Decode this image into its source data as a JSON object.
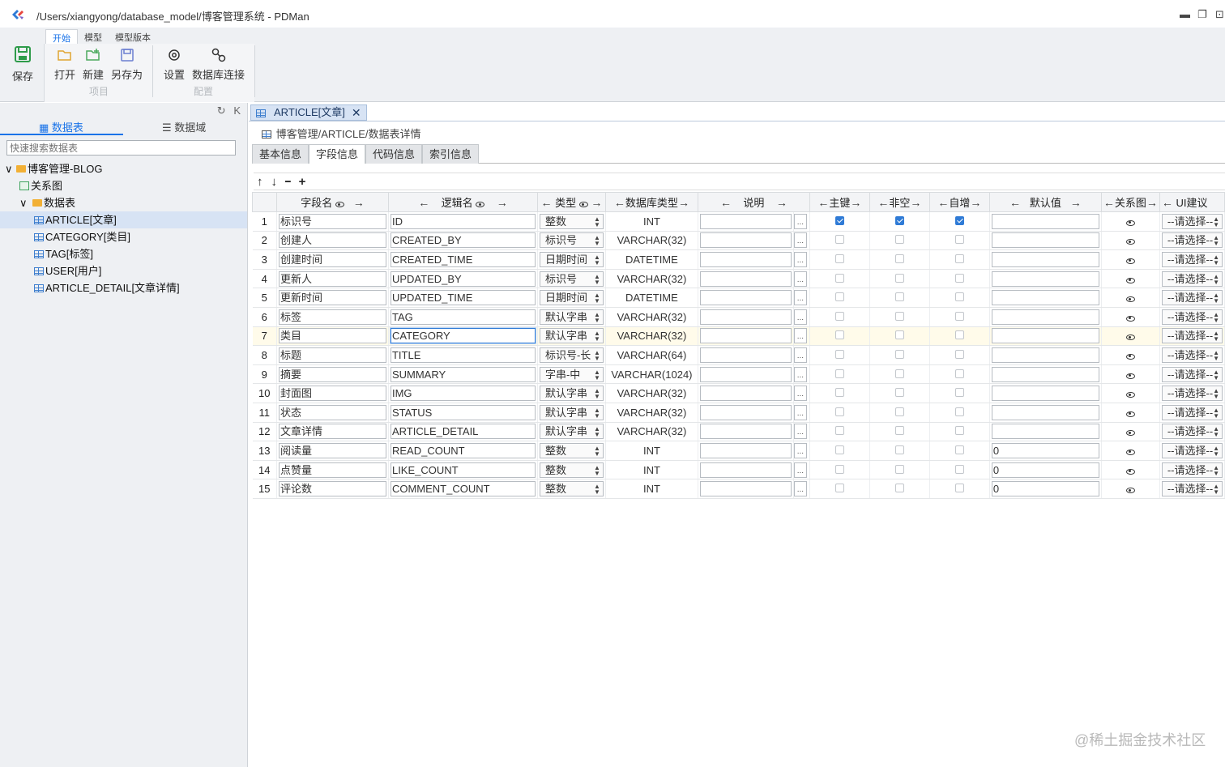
{
  "window": {
    "title": "/Users/xiangyong/database_model/博客管理系统 - PDMan",
    "controls": [
      "▬",
      "❐",
      "⊡"
    ]
  },
  "ribbon": {
    "tabs": [
      "开始",
      "模型",
      "模型版本"
    ],
    "save_label": "保存",
    "open_label": "打开",
    "new_label": "新建",
    "saveas_label": "另存为",
    "project_group": "项目",
    "settings_label": "设置",
    "dbconn_label": "数据库连接",
    "config_group": "配置"
  },
  "sidebar": {
    "refresh_icon": "↻",
    "collapse_icon": "K",
    "tab_tables": "数据表",
    "tab_domains": "数据域",
    "search_placeholder": "快速搜索数据表",
    "tree": {
      "root": "博客管理-BLOG",
      "relation": "关系图",
      "tables_folder": "数据表",
      "tables": [
        "ARTICLE[文章]",
        "CATEGORY[类目]",
        "TAG[标签]",
        "USER[用户]",
        "ARTICLE_DETAIL[文章详情]"
      ]
    }
  },
  "main": {
    "doc_tab": "ARTICLE[文章]",
    "breadcrumb": "博客管理/ARTICLE/数据表详情",
    "sub_tabs": [
      "基本信息",
      "字段信息",
      "代码信息",
      "索引信息"
    ],
    "tools": [
      "↑",
      "↓",
      "━",
      "+"
    ],
    "columns": [
      "字段名",
      "逻辑名",
      "类型",
      "数据库类型",
      "说明",
      "主键",
      "非空",
      "自增",
      "默认值",
      "关系图",
      "UI建议"
    ],
    "select_placeholder": "--请选择--",
    "rows": [
      {
        "no": "1",
        "name": "标识号",
        "code": "ID",
        "type": "整数",
        "dbtype": "INT",
        "pk": true,
        "nn": true,
        "ai": true,
        "def": ""
      },
      {
        "no": "2",
        "name": "创建人",
        "code": "CREATED_BY",
        "type": "标识号",
        "dbtype": "VARCHAR(32)",
        "pk": false,
        "nn": false,
        "ai": false,
        "def": ""
      },
      {
        "no": "3",
        "name": "创建时间",
        "code": "CREATED_TIME",
        "type": "日期时间",
        "dbtype": "DATETIME",
        "pk": false,
        "nn": false,
        "ai": false,
        "def": ""
      },
      {
        "no": "4",
        "name": "更新人",
        "code": "UPDATED_BY",
        "type": "标识号",
        "dbtype": "VARCHAR(32)",
        "pk": false,
        "nn": false,
        "ai": false,
        "def": ""
      },
      {
        "no": "5",
        "name": "更新时间",
        "code": "UPDATED_TIME",
        "type": "日期时间",
        "dbtype": "DATETIME",
        "pk": false,
        "nn": false,
        "ai": false,
        "def": ""
      },
      {
        "no": "6",
        "name": "标签",
        "code": "TAG",
        "type": "默认字串",
        "dbtype": "VARCHAR(32)",
        "pk": false,
        "nn": false,
        "ai": false,
        "def": ""
      },
      {
        "no": "7",
        "name": "类目",
        "code": "CATEGORY",
        "type": "默认字串",
        "dbtype": "VARCHAR(32)",
        "pk": false,
        "nn": false,
        "ai": false,
        "def": ""
      },
      {
        "no": "8",
        "name": "标题",
        "code": "TITLE",
        "type": "标识号-长",
        "dbtype": "VARCHAR(64)",
        "pk": false,
        "nn": false,
        "ai": false,
        "def": ""
      },
      {
        "no": "9",
        "name": "摘要",
        "code": "SUMMARY",
        "type": "字串-中",
        "dbtype": "VARCHAR(1024)",
        "pk": false,
        "nn": false,
        "ai": false,
        "def": ""
      },
      {
        "no": "10",
        "name": "封面图",
        "code": "IMG",
        "type": "默认字串",
        "dbtype": "VARCHAR(32)",
        "pk": false,
        "nn": false,
        "ai": false,
        "def": ""
      },
      {
        "no": "11",
        "name": "状态",
        "code": "STATUS",
        "type": "默认字串",
        "dbtype": "VARCHAR(32)",
        "pk": false,
        "nn": false,
        "ai": false,
        "def": ""
      },
      {
        "no": "12",
        "name": "文章详情",
        "code": "ARTICLE_DETAIL",
        "type": "默认字串",
        "dbtype": "VARCHAR(32)",
        "pk": false,
        "nn": false,
        "ai": false,
        "def": ""
      },
      {
        "no": "13",
        "name": "阅读量",
        "code": "READ_COUNT",
        "type": "整数",
        "dbtype": "INT",
        "pk": false,
        "nn": false,
        "ai": false,
        "def": "0"
      },
      {
        "no": "14",
        "name": "点赞量",
        "code": "LIKE_COUNT",
        "type": "整数",
        "dbtype": "INT",
        "pk": false,
        "nn": false,
        "ai": false,
        "def": "0"
      },
      {
        "no": "15",
        "name": "评论数",
        "code": "COMMENT_COUNT",
        "type": "整数",
        "dbtype": "INT",
        "pk": false,
        "nn": false,
        "ai": false,
        "def": "0"
      }
    ]
  },
  "watermark": "@稀土掘金技术社区",
  "colors": {
    "accent": "#1a73e8",
    "selected_row": "#d7e3f4",
    "highlight_row": "#fffbea"
  }
}
